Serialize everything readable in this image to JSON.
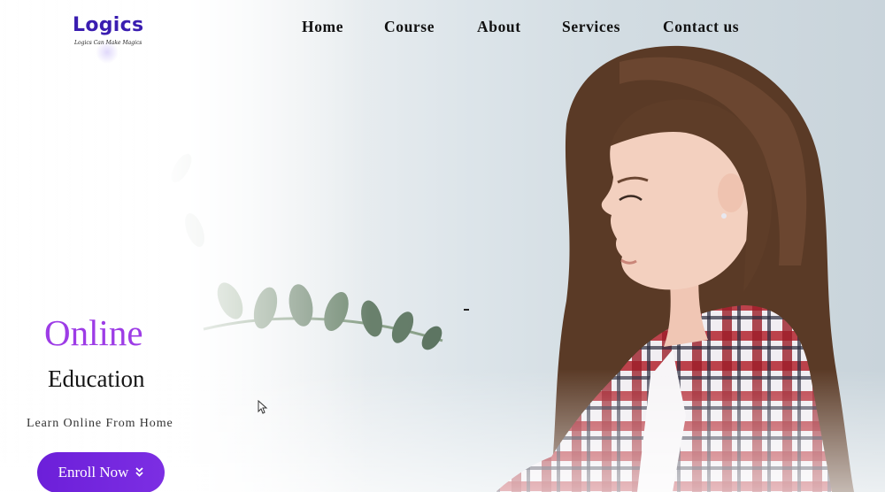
{
  "brand": {
    "name": "Logics",
    "tagline": "Logics Can Make Magics",
    "colors": {
      "logo": "#3a1db0",
      "accent": "#9d3ce6",
      "button": "#6c1fd9"
    }
  },
  "nav": {
    "items": [
      {
        "label": "Home"
      },
      {
        "label": "Course"
      },
      {
        "label": "About"
      },
      {
        "label": "Services"
      },
      {
        "label": "Contact us"
      }
    ]
  },
  "hero": {
    "title_line1": "Online",
    "title_line2": "Education",
    "subtitle": "Learn Online From Home",
    "cta": {
      "label": "Enroll Now",
      "icon": "chevrons-down-icon"
    },
    "image": "girl-with-long-hair-in-plaid-shirt-photo"
  }
}
